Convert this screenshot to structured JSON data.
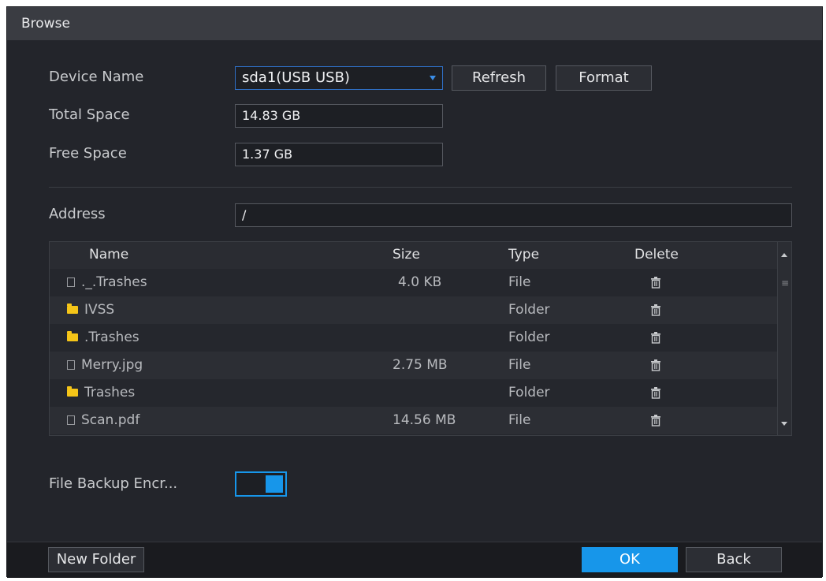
{
  "window": {
    "title": "Browse"
  },
  "device": {
    "name_label": "Device Name",
    "name_value": "sda1(USB USB)",
    "total_label": "Total Space",
    "total_value": "14.83 GB",
    "free_label": "Free Space",
    "free_value": "1.37 GB",
    "refresh_label": "Refresh",
    "format_label": "Format"
  },
  "address": {
    "label": "Address",
    "value": "/"
  },
  "table": {
    "headers": {
      "name": "Name",
      "size": "Size",
      "type": "Type",
      "delete": "Delete"
    },
    "rows": [
      {
        "icon": "file-icon",
        "name": "._.Trashes",
        "size": "4.0 KB",
        "type": "File"
      },
      {
        "icon": "folder-icon",
        "name": "IVSS",
        "size": "",
        "type": "Folder"
      },
      {
        "icon": "folder-icon",
        "name": ".Trashes",
        "size": "",
        "type": "Folder"
      },
      {
        "icon": "file-icon",
        "name": "Merry.jpg",
        "size": "2.75 MB",
        "type": "File"
      },
      {
        "icon": "folder-icon",
        "name": "Trashes",
        "size": "",
        "type": "Folder"
      },
      {
        "icon": "file-icon",
        "name": "Scan.pdf",
        "size": "14.56 MB",
        "type": "File"
      }
    ]
  },
  "encryption": {
    "label": "File Backup Encr...",
    "enabled": true
  },
  "footer": {
    "new_folder_label": "New Folder",
    "ok_label": "OK",
    "back_label": "Back"
  },
  "colors": {
    "accent": "#1796ea",
    "folder": "#f5c518",
    "background": "#23252b"
  }
}
